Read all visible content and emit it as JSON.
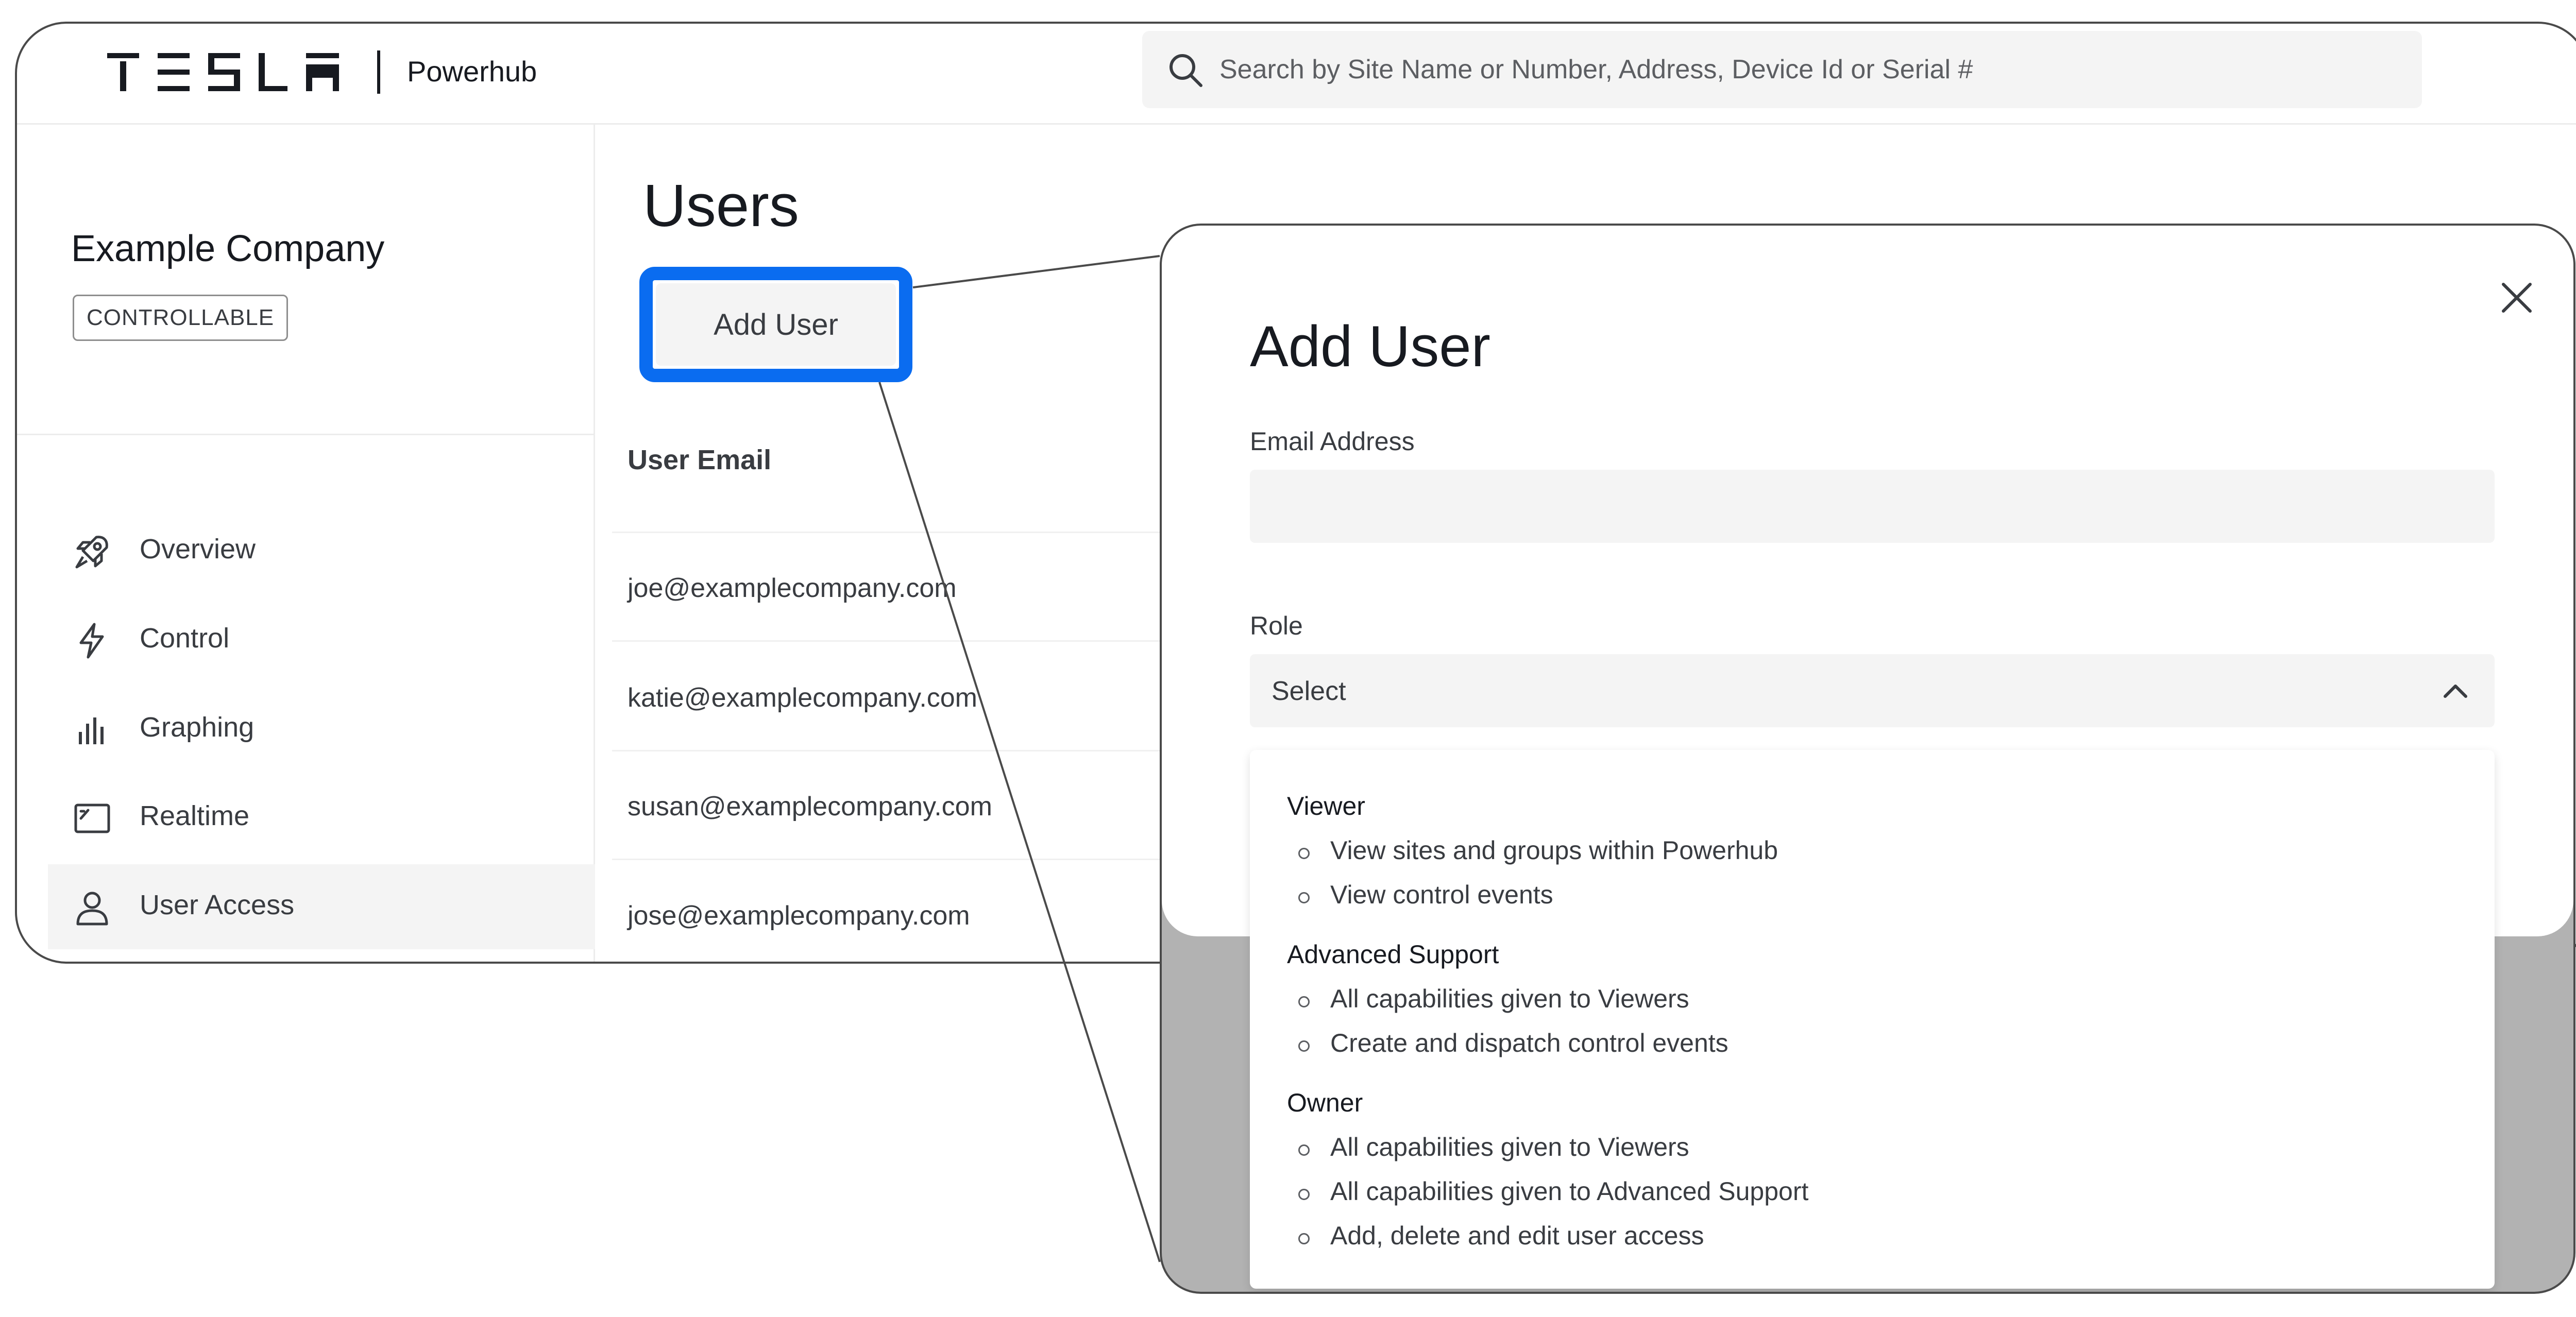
{
  "header": {
    "app_name": "Powerhub",
    "logo_icon": "tesla-wordmark",
    "search": {
      "icon": "search-icon",
      "placeholder": "Search by Site Name or Number, Address, Device Id or Serial #"
    }
  },
  "sidebar": {
    "company_name": "Example Company",
    "company_badge": "CONTROLLABLE",
    "items": [
      {
        "label": "Overview",
        "icon": "rocket-icon"
      },
      {
        "label": "Control",
        "icon": "lightning-bolt-icon"
      },
      {
        "label": "Graphing",
        "icon": "bar-chart-icon"
      },
      {
        "label": "Realtime",
        "icon": "gauge-window-icon"
      },
      {
        "label": "User Access",
        "icon": "user-icon",
        "active": true
      }
    ]
  },
  "main": {
    "title": "Users",
    "add_user_label": "Add User",
    "table": {
      "column_header": "User Email",
      "rows": [
        "joe@examplecompany.com",
        "katie@examplecompany.com",
        "susan@examplecompany.com",
        "jose@examplecompany.com"
      ]
    }
  },
  "modal": {
    "title": "Add User",
    "close_icon": "close-icon",
    "email_label": "Email Address",
    "email_value": "",
    "role_label": "Role",
    "role_value": "Select",
    "roles": [
      {
        "name": "Viewer",
        "capabilities": [
          "View sites and groups within Powerhub",
          "View control events"
        ]
      },
      {
        "name": "Advanced Support",
        "capabilities": [
          "All capabilities given to Viewers",
          "Create and dispatch control events"
        ]
      },
      {
        "name": "Owner",
        "capabilities": [
          "All capabilities given to Viewers",
          "All capabilities given to Advanced Support",
          "Add, delete and edit user access"
        ]
      }
    ]
  },
  "colors": {
    "highlight": "#0a6cf0",
    "text": "#171a20",
    "muted_text": "#393c41",
    "field_bg": "#f4f4f4"
  }
}
